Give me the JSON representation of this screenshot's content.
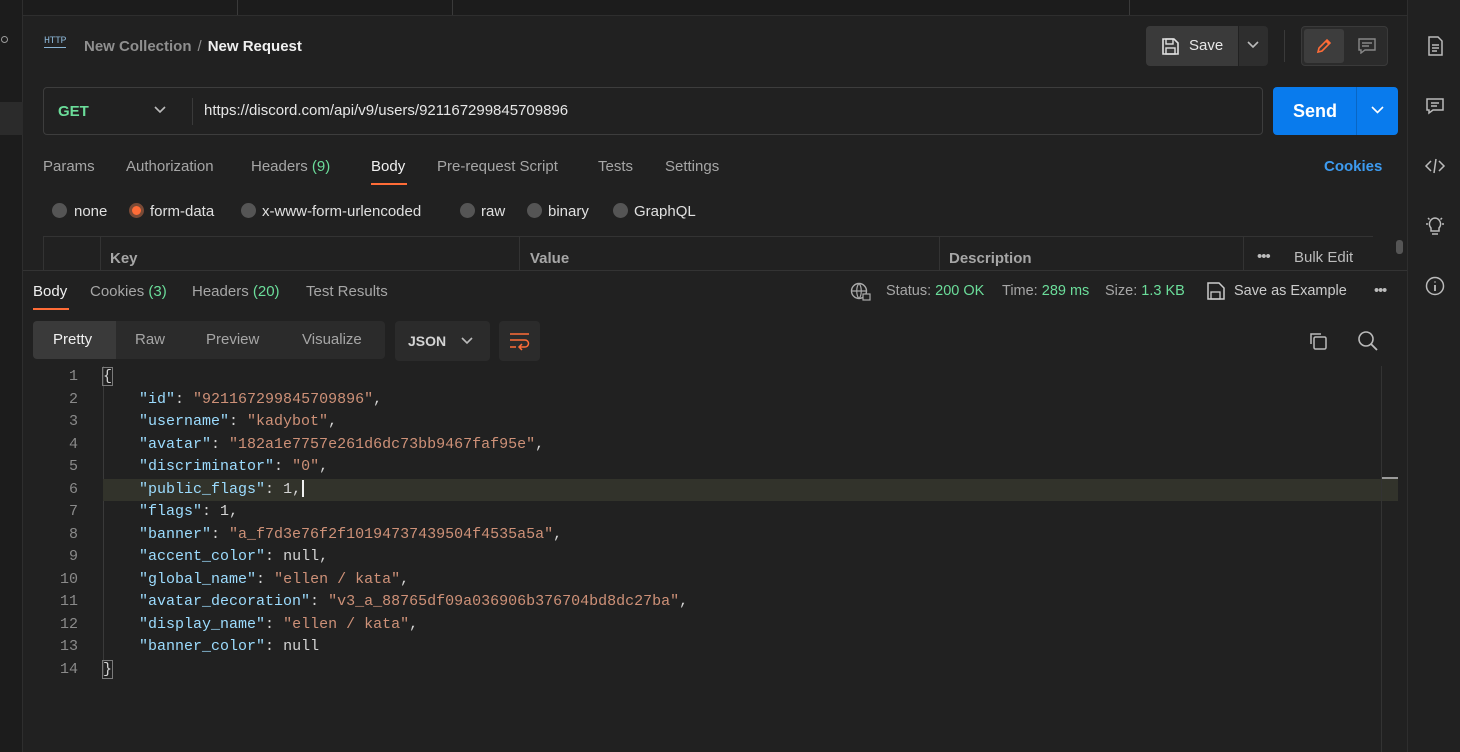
{
  "header": {
    "http_icon": "HTTP",
    "collection": "New Collection",
    "separator": "/",
    "request_name": "New Request",
    "save_label": "Save"
  },
  "request": {
    "method": "GET",
    "url": "https://discord.com/api/v9/users/921167299845709896",
    "send_label": "Send"
  },
  "req_tabs": {
    "params": "Params",
    "authorization": "Authorization",
    "headers": "Headers",
    "headers_count": "(9)",
    "body": "Body",
    "prerequest": "Pre-request Script",
    "tests": "Tests",
    "settings": "Settings",
    "cookies": "Cookies"
  },
  "body_types": {
    "none": "none",
    "form_data": "form-data",
    "urlencoded": "x-www-form-urlencoded",
    "raw": "raw",
    "binary": "binary",
    "graphql": "GraphQL",
    "selected": "form-data"
  },
  "kv_table": {
    "key": "Key",
    "value": "Value",
    "description": "Description",
    "more": "•••",
    "bulk_edit": "Bulk Edit"
  },
  "response": {
    "tabs": {
      "body": "Body",
      "cookies": "Cookies",
      "cookies_count": "(3)",
      "headers": "Headers",
      "headers_count": "(20)",
      "test_results": "Test Results"
    },
    "status_label": "Status:",
    "status_value": "200 OK",
    "time_label": "Time:",
    "time_value": "289 ms",
    "size_label": "Size:",
    "size_value": "1.3 KB",
    "save_example": "Save as Example",
    "more": "•••"
  },
  "view": {
    "pretty": "Pretty",
    "raw": "Raw",
    "preview": "Preview",
    "visualize": "Visualize",
    "format": "JSON"
  },
  "code_lines": [
    {
      "n": "1",
      "key": "",
      "val": "",
      "type": "open"
    },
    {
      "n": "2",
      "key": "\"id\"",
      "val": "\"921167299845709896\"",
      "type": "str",
      "comma": ","
    },
    {
      "n": "3",
      "key": "\"username\"",
      "val": "\"kadybot\"",
      "type": "str",
      "comma": ","
    },
    {
      "n": "4",
      "key": "\"avatar\"",
      "val": "\"182a1e7757e261d6dc73bb9467faf95e\"",
      "type": "str",
      "comma": ","
    },
    {
      "n": "5",
      "key": "\"discriminator\"",
      "val": "\"0\"",
      "type": "str",
      "comma": ","
    },
    {
      "n": "6",
      "key": "\"public_flags\"",
      "val": "1",
      "type": "num",
      "comma": ","
    },
    {
      "n": "7",
      "key": "\"flags\"",
      "val": "1",
      "type": "num",
      "comma": ","
    },
    {
      "n": "8",
      "key": "\"banner\"",
      "val": "\"a_f7d3e76f2f10194737439504f4535a5a\"",
      "type": "str",
      "comma": ","
    },
    {
      "n": "9",
      "key": "\"accent_color\"",
      "val": "null",
      "type": "num",
      "comma": ","
    },
    {
      "n": "10",
      "key": "\"global_name\"",
      "val": "\"ellen / kata\"",
      "type": "str",
      "comma": ","
    },
    {
      "n": "11",
      "key": "\"avatar_decoration\"",
      "val": "\"v3_a_88765df09a036906b376704bd8dc27ba\"",
      "type": "str",
      "comma": ","
    },
    {
      "n": "12",
      "key": "\"display_name\"",
      "val": "\"ellen / kata\"",
      "type": "str",
      "comma": ","
    },
    {
      "n": "13",
      "key": "\"banner_color\"",
      "val": "null",
      "type": "num",
      "comma": ""
    },
    {
      "n": "14",
      "key": "",
      "val": "",
      "type": "close"
    }
  ],
  "colors": {
    "accent": "#ff6c37",
    "send": "#097bed",
    "success": "#6bdd9a",
    "link": "#3d9bf0"
  },
  "icons": [
    "http-icon",
    "save-icon",
    "chevron-down-icon",
    "pencil-icon",
    "comment-icon",
    "document-icon",
    "chat-icon",
    "code-icon",
    "lightbulb-icon",
    "info-icon",
    "globe-icon",
    "wrap-icon",
    "copy-icon",
    "search-icon"
  ]
}
